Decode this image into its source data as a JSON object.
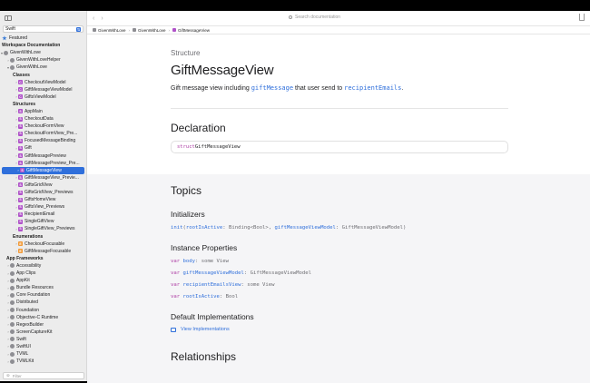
{
  "sidebar": {
    "language": "Swift",
    "filter_placeholder": "Filter",
    "items": [
      {
        "label": "Featured",
        "kind": "star",
        "indent": 2
      },
      {
        "label": "Workspace Documentation",
        "kind": "head",
        "indent": 2
      },
      {
        "label": "GivenWithLove",
        "kind": "fw",
        "indent": 0,
        "tri": "▾"
      },
      {
        "label": "GivenWithLoveHelper",
        "kind": "fw",
        "indent": 7,
        "tri": "›"
      },
      {
        "label": "GivenWithLove",
        "kind": "fw",
        "indent": 7,
        "tri": "▾"
      },
      {
        "label": "Classes",
        "kind": "head",
        "indent": 14
      },
      {
        "label": "CheckoutViewModel",
        "kind": "c",
        "indent": 16,
        "tri": "›",
        "badge": "C"
      },
      {
        "label": "GiftMessageViewModel",
        "kind": "c",
        "indent": 16,
        "tri": "›",
        "badge": "C"
      },
      {
        "label": "GiftsViewModel",
        "kind": "c",
        "indent": 16,
        "tri": "›",
        "badge": "C"
      },
      {
        "label": "Structures",
        "kind": "head",
        "indent": 14
      },
      {
        "label": "AppMain",
        "kind": "s",
        "indent": 16,
        "tri": "›",
        "badge": "S"
      },
      {
        "label": "CheckoutData",
        "kind": "s",
        "indent": 16,
        "tri": "›",
        "badge": "S"
      },
      {
        "label": "CheckoutFormView",
        "kind": "s",
        "indent": 16,
        "tri": "›",
        "badge": "S"
      },
      {
        "label": "CheckoutFormView_Pre...",
        "kind": "s",
        "indent": 16,
        "tri": "›",
        "badge": "S"
      },
      {
        "label": "FocusedMessageBinding",
        "kind": "s",
        "indent": 16,
        "tri": "›",
        "badge": "S"
      },
      {
        "label": "Gift",
        "kind": "s",
        "indent": 16,
        "tri": "›",
        "badge": "S"
      },
      {
        "label": "GiftMessagePreview",
        "kind": "s",
        "indent": 16,
        "tri": "›",
        "badge": "S"
      },
      {
        "label": "GiftMessagePreview_Pre...",
        "kind": "s",
        "indent": 16,
        "tri": "›",
        "badge": "S"
      },
      {
        "label": "GiftMessageView",
        "kind": "s",
        "indent": 16,
        "tri": "›",
        "badge": "S",
        "selected": true
      },
      {
        "label": "GiftMessageView_Previe...",
        "kind": "s",
        "indent": 16,
        "tri": "›",
        "badge": "S"
      },
      {
        "label": "GiftsGridView",
        "kind": "s",
        "indent": 16,
        "tri": "›",
        "badge": "S"
      },
      {
        "label": "GiftsGridView_Previews",
        "kind": "s",
        "indent": 16,
        "tri": "›",
        "badge": "S"
      },
      {
        "label": "GiftsHomeView",
        "kind": "s",
        "indent": 16,
        "tri": "›",
        "badge": "S"
      },
      {
        "label": "GiftsView_Previews",
        "kind": "s",
        "indent": 16,
        "tri": "›",
        "badge": "S"
      },
      {
        "label": "RecipientEmail",
        "kind": "s",
        "indent": 16,
        "tri": "›",
        "badge": "S"
      },
      {
        "label": "SingleGiftView",
        "kind": "s",
        "indent": 16,
        "tri": "›",
        "badge": "S"
      },
      {
        "label": "SingleGiftView_Previews",
        "kind": "s",
        "indent": 16,
        "tri": "›",
        "badge": "S"
      },
      {
        "label": "Enumerations",
        "kind": "head",
        "indent": 14
      },
      {
        "label": "CheckoutFocusable",
        "kind": "e",
        "indent": 16,
        "tri": "›",
        "badge": "E"
      },
      {
        "label": "GiftMessageFocusable",
        "kind": "e",
        "indent": 16,
        "tri": "›",
        "badge": "E"
      },
      {
        "label": "App Frameworks",
        "kind": "head",
        "indent": 7
      },
      {
        "label": "Accessibility",
        "kind": "fw",
        "indent": 7,
        "tri": "›"
      },
      {
        "label": "App Clips",
        "kind": "fw",
        "indent": 7,
        "tri": "›"
      },
      {
        "label": "AppKit",
        "kind": "fw",
        "indent": 7,
        "tri": "›"
      },
      {
        "label": "Bundle Resources",
        "kind": "fw",
        "indent": 7,
        "tri": "›"
      },
      {
        "label": "Core Foundation",
        "kind": "fw",
        "indent": 7,
        "tri": "›"
      },
      {
        "label": "Distributed",
        "kind": "fw",
        "indent": 7,
        "tri": "›"
      },
      {
        "label": "Foundation",
        "kind": "fw",
        "indent": 7,
        "tri": "›"
      },
      {
        "label": "Objective-C Runtime",
        "kind": "fw",
        "indent": 7,
        "tri": "›"
      },
      {
        "label": "RegexBuilder",
        "kind": "fw",
        "indent": 7,
        "tri": "›"
      },
      {
        "label": "ScreenCaptureKit",
        "kind": "fw",
        "indent": 7,
        "tri": "›"
      },
      {
        "label": "Swift",
        "kind": "fw",
        "indent": 7,
        "tri": "›"
      },
      {
        "label": "SwiftUI",
        "kind": "fw",
        "indent": 7,
        "tri": "›"
      },
      {
        "label": "TVML",
        "kind": "fw",
        "indent": 7,
        "tri": "›"
      },
      {
        "label": "TVMLKit",
        "kind": "fw",
        "indent": 7,
        "tri": "›"
      }
    ]
  },
  "toolbar": {
    "back": "‹",
    "forward": "›",
    "search_placeholder": "Search documentation"
  },
  "breadcrumbs": [
    {
      "label": "GivenWithLove",
      "color": "#8e8e93"
    },
    {
      "label": "GivenWithLove",
      "color": "#8e8e93"
    },
    {
      "label": "GiftMessageView",
      "color": "#b052c9"
    }
  ],
  "page": {
    "eyebrow": "Structure",
    "title": "GiftMessageView",
    "abstract_pre": "Gift message view including ",
    "abstract_code1": "giftMessage",
    "abstract_mid": " that user send to ",
    "abstract_code2": "recipientEmails",
    "abstract_post": ".",
    "declaration_heading": "Declaration",
    "declaration_kw": "struct",
    "declaration_name": " GiftMessageView",
    "topics_heading": "Topics",
    "initializers_heading": "Initializers",
    "init_name": "init",
    "init_p1": "rootIsActive",
    "init_t1": ": Binding<Bool>, ",
    "init_p2": "giftMessageViewModel",
    "init_t2": ": GiftMessageViewModel)",
    "instance_properties_heading": "Instance Properties",
    "properties": [
      {
        "kw": "var",
        "name": "body",
        "type": ": some View"
      },
      {
        "kw": "var",
        "name": "giftMessageViewModel",
        "type": ": GiftMessageViewModel"
      },
      {
        "kw": "var",
        "name": "recipientEmailsView",
        "type": ": some View"
      },
      {
        "kw": "var",
        "name": "rootIsActive",
        "type": ": Bool"
      }
    ],
    "default_impl_heading": "Default Implementations",
    "view_impl_link": "View Implementations",
    "relationships_heading": "Relationships"
  }
}
